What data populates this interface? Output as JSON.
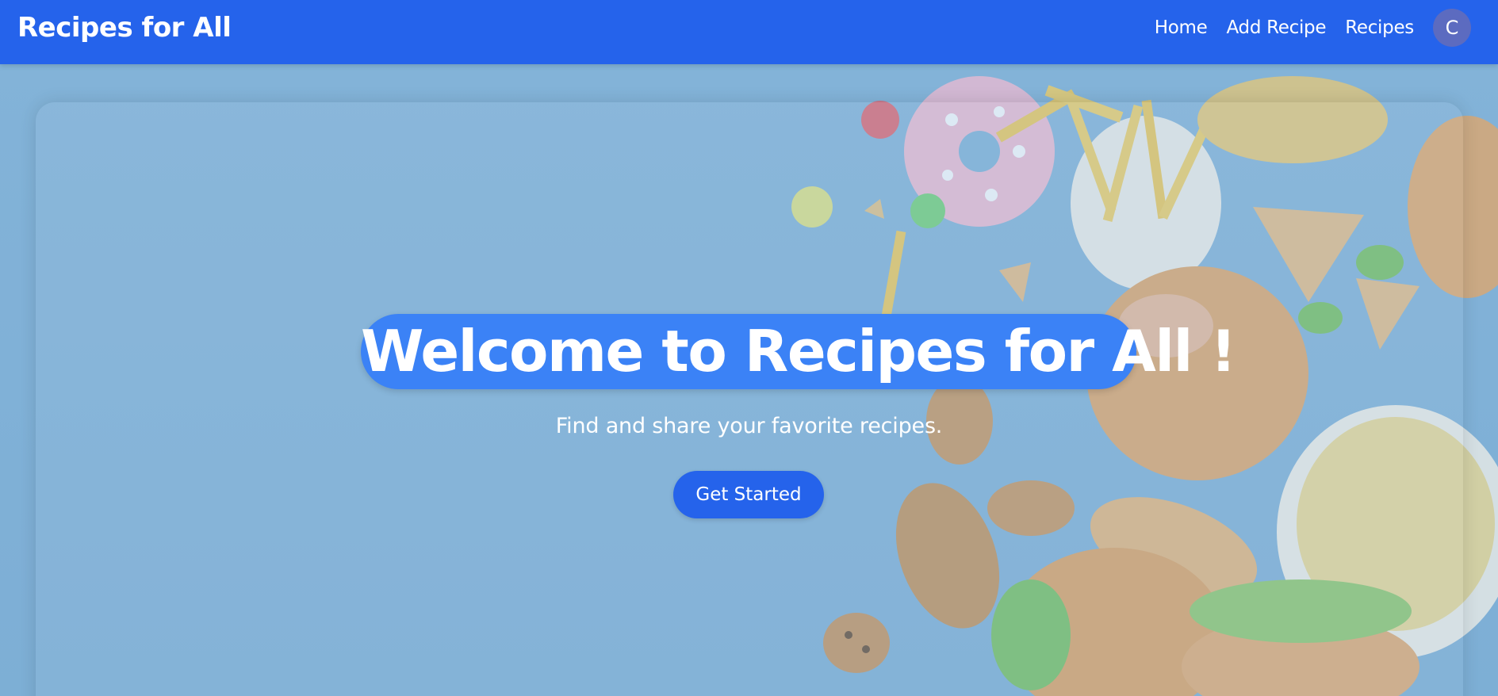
{
  "header": {
    "brand": "Recipes for All",
    "nav": {
      "home": "Home",
      "add_recipe": "Add Recipe",
      "recipes": "Recipes"
    },
    "avatar_initial": "C"
  },
  "hero": {
    "title": "Welcome to Recipes for All !",
    "subtitle": "Find and share your favorite recipes.",
    "cta_label": "Get Started",
    "background_image": "food-collage-image"
  },
  "colors": {
    "header_bg": "#2563eb",
    "title_pill": "#3b82f6",
    "cta_bg": "#2563eb",
    "avatar_bg": "#5c6bc0",
    "hero_bg": "#7aaed4"
  }
}
